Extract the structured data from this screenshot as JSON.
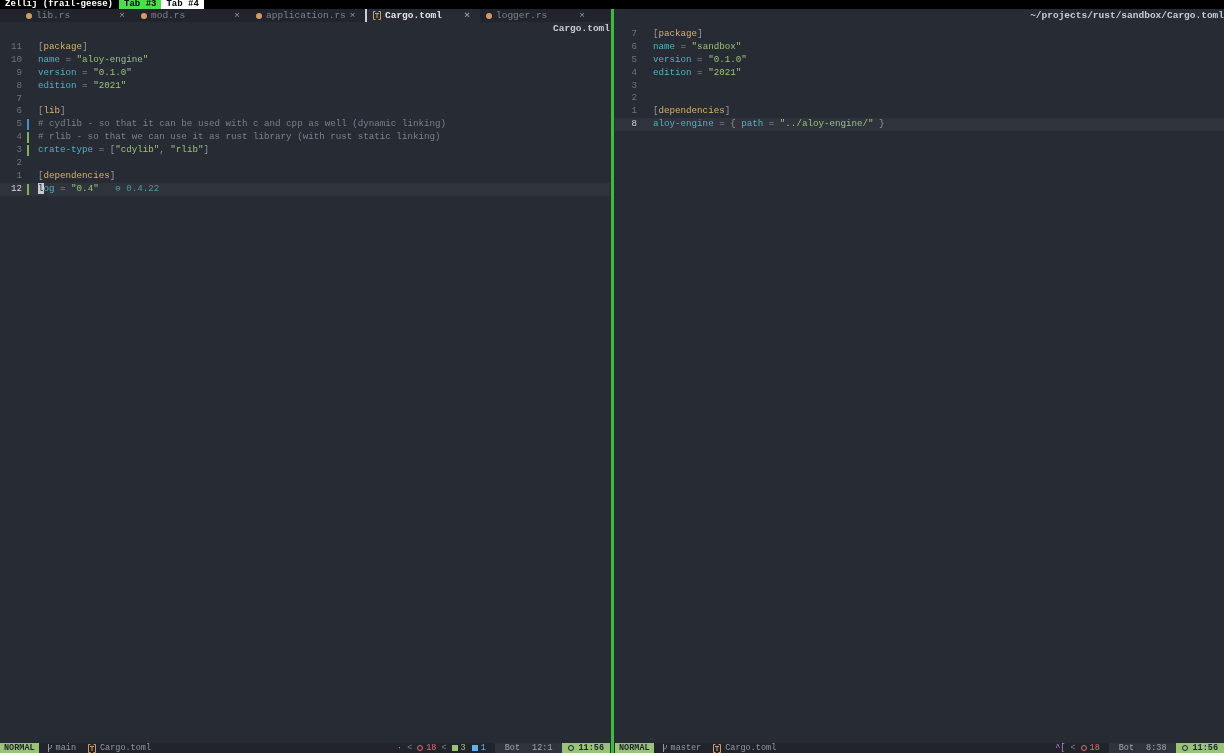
{
  "multiplexer": {
    "session": "Zellij (frail-geese)",
    "tabs": [
      {
        "label": "Tab #3",
        "selected": true
      },
      {
        "label": "Tab #4",
        "selected": false
      }
    ]
  },
  "panes": [
    {
      "tabs": [
        {
          "label": "lib.rs",
          "selected": false,
          "kind": "rust",
          "close": "×"
        },
        {
          "label": "mod.rs",
          "selected": false,
          "kind": "rust",
          "close": "×"
        },
        {
          "label": "application.rs",
          "selected": false,
          "kind": "rust",
          "close": "×"
        },
        {
          "label": "Cargo.toml",
          "selected": true,
          "kind": "toml",
          "close": "×"
        },
        {
          "label": "logger.rs",
          "selected": false,
          "kind": "rust",
          "close": "×"
        }
      ],
      "header": "Cargo.toml",
      "lines": [
        {
          "number": "11",
          "current": false,
          "kind": "plain",
          "tokens": [
            {
              "kind": "punct",
              "text": "["
            },
            {
              "kind": "section",
              "text": "package"
            },
            {
              "kind": "punct",
              "text": "]"
            }
          ]
        },
        {
          "number": "10",
          "current": false,
          "kind": "plain",
          "tokens": [
            {
              "kind": "key",
              "text": "name"
            },
            {
              "kind": "punct",
              "text": " = "
            },
            {
              "kind": "string",
              "text": "\"aloy-engine\""
            }
          ]
        },
        {
          "number": "9",
          "current": false,
          "kind": "plain",
          "tokens": [
            {
              "kind": "key",
              "text": "version"
            },
            {
              "kind": "punct",
              "text": " = "
            },
            {
              "kind": "string",
              "text": "\"0.1.0\""
            }
          ]
        },
        {
          "number": "8",
          "current": false,
          "kind": "plain",
          "tokens": [
            {
              "kind": "key",
              "text": "edition"
            },
            {
              "kind": "punct",
              "text": " = "
            },
            {
              "kind": "string",
              "text": "\"2021\""
            }
          ]
        },
        {
          "number": "7",
          "current": false,
          "kind": "plain"
        },
        {
          "number": "6",
          "current": false,
          "kind": "plain",
          "tokens": [
            {
              "kind": "punct",
              "text": "["
            },
            {
              "kind": "section",
              "text": "lib"
            },
            {
              "kind": "punct",
              "text": "]"
            }
          ]
        },
        {
          "number": "5",
          "current": false,
          "kind": "modified",
          "tokens": [
            {
              "kind": "comment",
              "text": "# cydlib - so that it can be used with c and cpp as well (dynamic linking)"
            }
          ]
        },
        {
          "number": "4",
          "current": false,
          "kind": "added",
          "tokens": [
            {
              "kind": "comment",
              "text": "# rlib - so that we can use it as rust library (with rust static linking)"
            }
          ]
        },
        {
          "number": "3",
          "current": false,
          "kind": "added",
          "tokens": [
            {
              "kind": "key",
              "text": "crate-type"
            },
            {
              "kind": "punct",
              "text": " = ["
            },
            {
              "kind": "string",
              "text": "\"cdylib\""
            },
            {
              "kind": "punct",
              "text": ", "
            },
            {
              "kind": "string",
              "text": "\"rlib\""
            },
            {
              "kind": "punct",
              "text": "]"
            }
          ]
        },
        {
          "number": "2",
          "current": false,
          "kind": "plain"
        },
        {
          "number": "1",
          "current": false,
          "kind": "plain",
          "tokens": [
            {
              "kind": "punct",
              "text": "["
            },
            {
              "kind": "section",
              "text": "dependencies"
            },
            {
              "kind": "punct",
              "text": "]"
            }
          ]
        },
        {
          "number": "12",
          "current": true,
          "kind": "added",
          "tokens": [
            {
              "kind": "cursor",
              "text": "l"
            },
            {
              "kind": "key",
              "text": "og"
            },
            {
              "kind": "punct",
              "text": " = "
            },
            {
              "kind": "string",
              "text": "\"0.4\""
            },
            {
              "kind": "hint",
              "text": "   ⊖ 0.4.22"
            }
          ]
        }
      ],
      "status": {
        "mode": "NORMAL",
        "branch": "main",
        "file": "Cargo.toml",
        "items": [
          {
            "kind": "text",
            "text": "·"
          },
          {
            "kind": "sep",
            "text": "<"
          },
          {
            "kind": "error",
            "text": "18"
          },
          {
            "kind": "sep",
            "text": "<"
          },
          {
            "kind": "hint",
            "text": "3"
          },
          {
            "kind": "info",
            "text": "1"
          },
          {
            "kind": "position",
            "scroll": "Bot",
            "cursor": "12:1"
          },
          {
            "kind": "clock",
            "text": "11:56"
          }
        ]
      }
    },
    {
      "header": "~/projects/rust/sandbox/Cargo.toml",
      "lines": [
        {
          "number": "7",
          "current": false,
          "kind": "plain",
          "tokens": [
            {
              "kind": "punct",
              "text": "["
            },
            {
              "kind": "section",
              "text": "package"
            },
            {
              "kind": "punct",
              "text": "]"
            }
          ]
        },
        {
          "number": "6",
          "current": false,
          "kind": "plain",
          "tokens": [
            {
              "kind": "key",
              "text": "name"
            },
            {
              "kind": "punct",
              "text": " = "
            },
            {
              "kind": "string",
              "text": "\"sandbox\""
            }
          ]
        },
        {
          "number": "5",
          "current": false,
          "kind": "plain",
          "tokens": [
            {
              "kind": "key",
              "text": "version"
            },
            {
              "kind": "punct",
              "text": " = "
            },
            {
              "kind": "string",
              "text": "\"0.1.0\""
            }
          ]
        },
        {
          "number": "4",
          "current": false,
          "kind": "plain",
          "tokens": [
            {
              "kind": "key",
              "text": "edition"
            },
            {
              "kind": "punct",
              "text": " = "
            },
            {
              "kind": "string",
              "text": "\"2021\""
            }
          ]
        },
        {
          "number": "3",
          "current": false,
          "kind": "plain"
        },
        {
          "number": "2",
          "current": false,
          "kind": "plain"
        },
        {
          "number": "1",
          "current": false,
          "kind": "plain",
          "tokens": [
            {
              "kind": "punct",
              "text": "["
            },
            {
              "kind": "section",
              "text": "dependencies"
            },
            {
              "kind": "punct",
              "text": "]"
            }
          ]
        },
        {
          "number": "8",
          "current": true,
          "kind": "plain",
          "tokens": [
            {
              "kind": "key",
              "text": "aloy-engine"
            },
            {
              "kind": "punct",
              "text": " = { "
            },
            {
              "kind": "key",
              "text": "path"
            },
            {
              "kind": "punct",
              "text": " = "
            },
            {
              "kind": "string",
              "text": "\"../aloy-engine/\""
            },
            {
              "kind": "punct",
              "text": " }"
            }
          ]
        }
      ],
      "status": {
        "mode": "NORMAL",
        "branch": "master",
        "file": "Cargo.toml",
        "items": [
          {
            "kind": "text",
            "text": "^["
          },
          {
            "kind": "sep",
            "text": "<"
          },
          {
            "kind": "error",
            "text": "18"
          },
          {
            "kind": "position",
            "scroll": "Bot",
            "cursor": "8:38"
          },
          {
            "kind": "clock",
            "text": "11:56"
          }
        ]
      }
    }
  ]
}
